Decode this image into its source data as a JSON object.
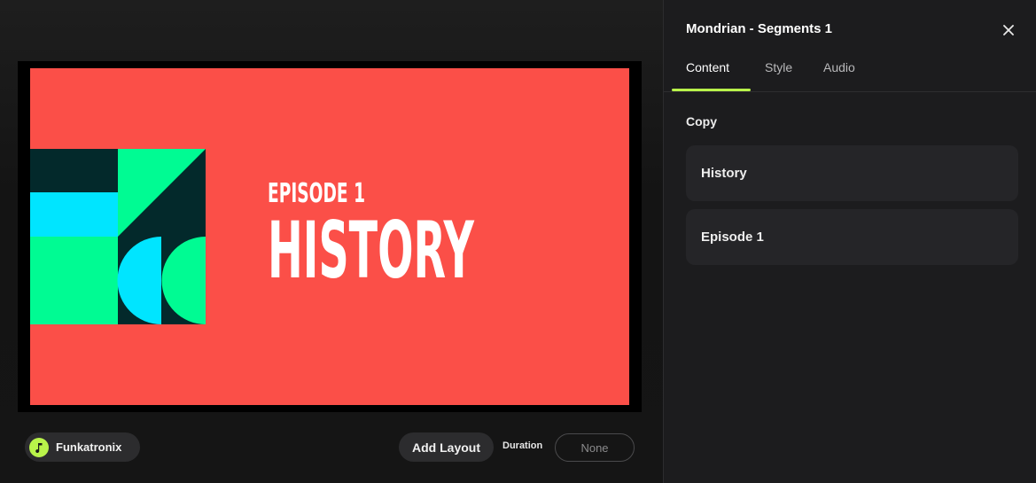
{
  "preview": {
    "slide_episode": "EPISODE 1",
    "slide_title": "HISTORY",
    "colors": {
      "background": "#fb4f48",
      "dark_teal": "#03292b",
      "cyan": "#00e5ff",
      "green": "#00fb93"
    }
  },
  "bottom_bar": {
    "music_label": "Funkatronix",
    "add_layout_label": "Add Layout",
    "duration_label": "Duration",
    "duration_value": "None"
  },
  "panel": {
    "title": "Mondrian - Segments 1",
    "tabs": [
      {
        "label": "Content",
        "active": true
      },
      {
        "label": "Style",
        "active": false
      },
      {
        "label": "Audio",
        "active": false
      }
    ],
    "section_label": "Copy",
    "fields": [
      {
        "value": "History"
      },
      {
        "value": "Episode 1"
      }
    ]
  },
  "accent_color": "#b9f34a"
}
